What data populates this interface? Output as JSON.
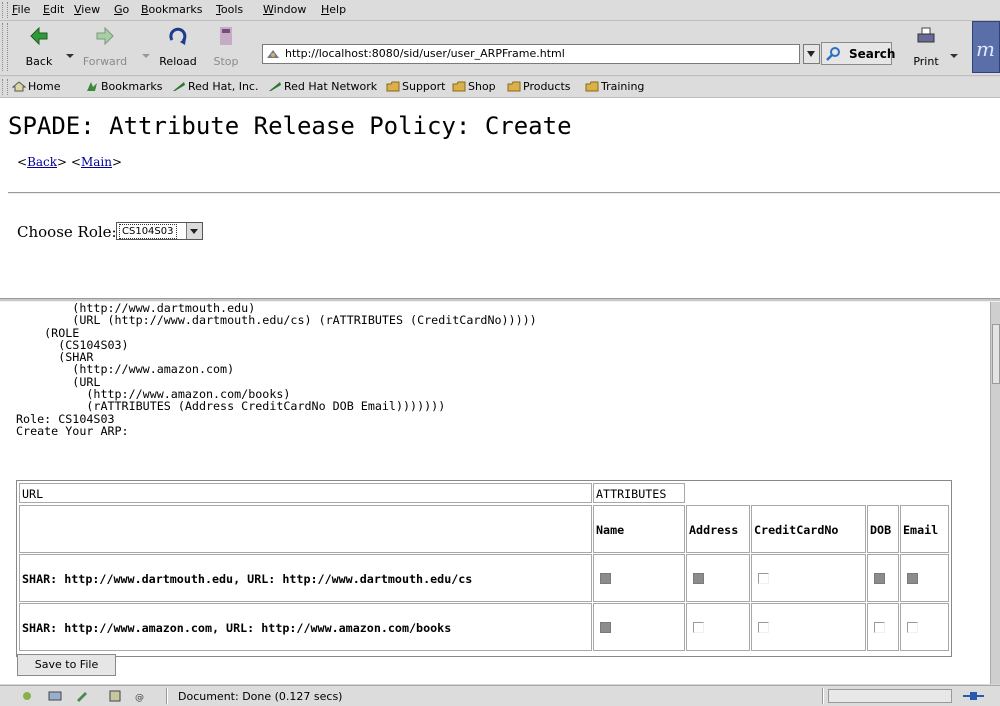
{
  "menu": [
    "File",
    "Edit",
    "View",
    "Go",
    "Bookmarks",
    "Tools",
    "Window",
    "Help"
  ],
  "menu_mnemonics": [
    "F",
    "E",
    "V",
    "G",
    "B",
    "T",
    "W",
    "H"
  ],
  "nav": {
    "back": "Back",
    "forward": "Forward",
    "reload": "Reload",
    "stop": "Stop",
    "url": "http://localhost:8080/sid/user/user_ARPFrame.html",
    "search": "Search",
    "print": "Print"
  },
  "bookmarks": [
    "Home",
    "Bookmarks",
    "Red Hat, Inc.",
    "Red Hat Network",
    "Support",
    "Shop",
    "Products",
    "Training"
  ],
  "page": {
    "title": "SPADE: Attribute Release Policy: Create",
    "back_link": "Back",
    "main_link": "Main",
    "choose_role_label": "Choose Role:",
    "role_value": "CS104S03"
  },
  "policy_text": "        (http://www.dartmouth.edu)\n        (URL (http://www.dartmouth.edu/cs) (rATTRIBUTES (CreditCardNo)))))\n    (ROLE\n      (CS104S03)\n      (SHAR\n        (http://www.amazon.com)\n        (URL\n          (http://www.amazon.com/books)\n          (rATTRIBUTES (Address CreditCardNo DOB Email)))))))\nRole: CS104S03\nCreate Your ARP:",
  "table": {
    "url_header": "URL",
    "attributes_header": "ATTRIBUTES",
    "columns": [
      "Name",
      "Address",
      "CreditCardNo",
      "DOB",
      "Email"
    ],
    "rows": [
      {
        "label": "SHAR: http://www.dartmouth.edu, URL: http://www.dartmouth.edu/cs",
        "checked": [
          true,
          true,
          false,
          true,
          true
        ]
      },
      {
        "label": "SHAR: http://www.amazon.com, URL: http://www.amazon.com/books",
        "checked": [
          true,
          false,
          false,
          false,
          false
        ]
      }
    ]
  },
  "save_button": "Save to File",
  "status": "Document: Done (0.127 secs)"
}
